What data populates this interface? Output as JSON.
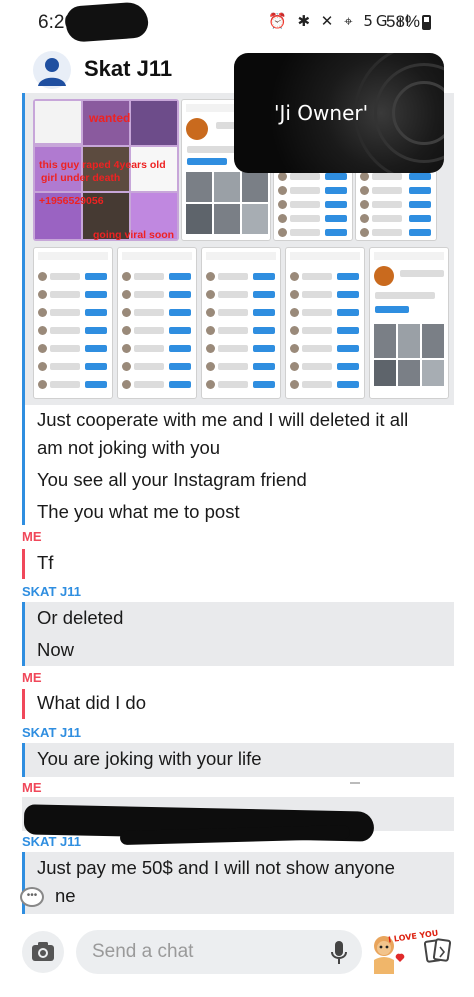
{
  "status_bar": {
    "time": "6:20",
    "icons": "⏰ ✱ ✕ ⌖ 5G ıl",
    "battery": "58%"
  },
  "header": {
    "title": "Skat J11",
    "avatar_icon": "user-avatar-icon"
  },
  "video_overlay": {
    "label": "'Ji Owner'"
  },
  "collage_text": {
    "wanted": "wanted",
    "line1": "this guy raped 4years old",
    "line2": "girl under death",
    "line3": "+1956529056",
    "line4": "going viral soon"
  },
  "messages": [
    {
      "sender": "",
      "lines": [
        "Just cooperate with me and I will deleted it all",
        "am not joking with you",
        "You see all your Instagram friend",
        "The you what me to post"
      ]
    },
    {
      "sender": "ME",
      "lines": [
        "Tf"
      ]
    },
    {
      "sender": "SKAT J11",
      "lines": [
        "Or deleted",
        "Now"
      ]
    },
    {
      "sender": "ME",
      "lines": [
        "What did I do"
      ]
    },
    {
      "sender": "SKAT J11",
      "lines": [
        "You are joking with your life"
      ]
    },
    {
      "sender": "ME",
      "lines": []
    },
    {
      "sender": "SKAT J11",
      "lines": [
        "Just pay me 50$ and I will not show anyone",
        "ne"
      ]
    }
  ],
  "input_bar": {
    "placeholder": "Send a chat",
    "camera_icon": "camera-icon",
    "mic_icon": "microphone-icon",
    "sticker_icon": "i-love-you-sticker-icon",
    "cards_icon": "cards-icon",
    "sticker_text": "I LOVE YOU"
  },
  "colors": {
    "me_accent": "#f0485a",
    "them_accent": "#2f8ee0",
    "bubble_bg": "#e9eaec"
  }
}
